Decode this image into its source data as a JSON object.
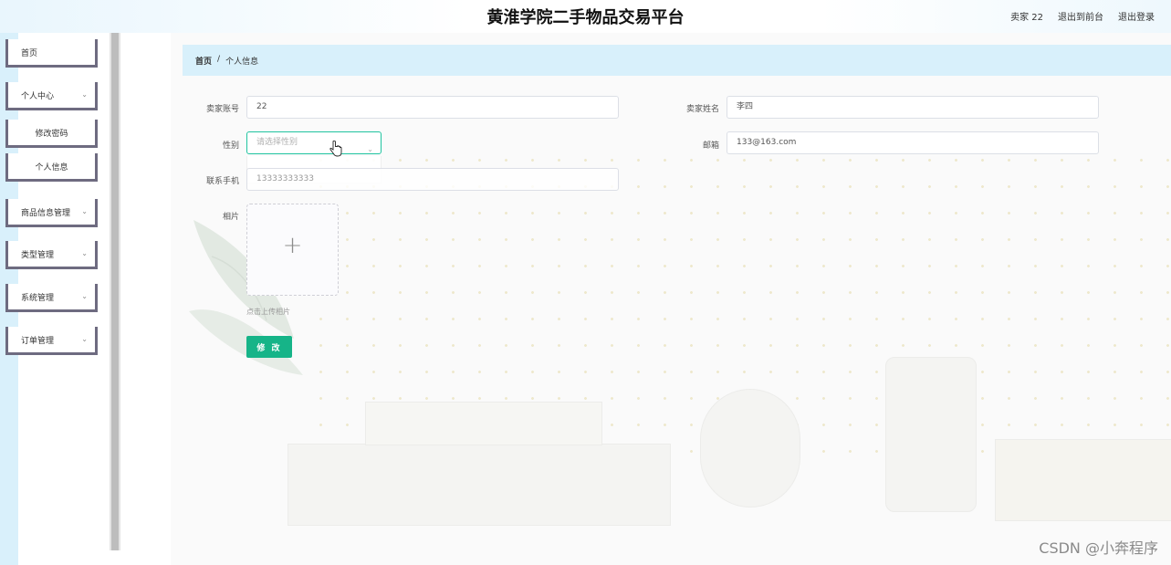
{
  "header": {
    "title": "黄淮学院二手物品交易平台",
    "user_label": "卖家 22",
    "to_front_label": "退出到前台",
    "logout_label": "退出登录"
  },
  "sidebar": {
    "items": [
      {
        "label": "首页"
      },
      {
        "label": "个人中心"
      },
      {
        "label": "修改密码"
      },
      {
        "label": "个人信息"
      },
      {
        "label": "商品信息管理"
      },
      {
        "label": "类型管理"
      },
      {
        "label": "系统管理"
      },
      {
        "label": "订单管理"
      }
    ]
  },
  "breadcrumb": {
    "home": "首页",
    "separator": "/",
    "current": "个人信息"
  },
  "form": {
    "account": {
      "label": "卖家账号",
      "value": "22"
    },
    "name": {
      "label": "卖家姓名",
      "value": "李四"
    },
    "gender": {
      "label": "性别",
      "placeholder": "请选择性别"
    },
    "email": {
      "label": "邮箱",
      "value": "133@163.com"
    },
    "phone": {
      "label": "联系手机",
      "value": "13333333333"
    },
    "photo": {
      "label": "相片",
      "hint": "点击上传相片"
    },
    "submit_label": "修 改"
  },
  "watermark": "CSDN @小奔程序",
  "colors": {
    "accent": "#16b488",
    "breadcrumb_bg": "#d8f0fb",
    "menu_border": "#6e6b80"
  }
}
